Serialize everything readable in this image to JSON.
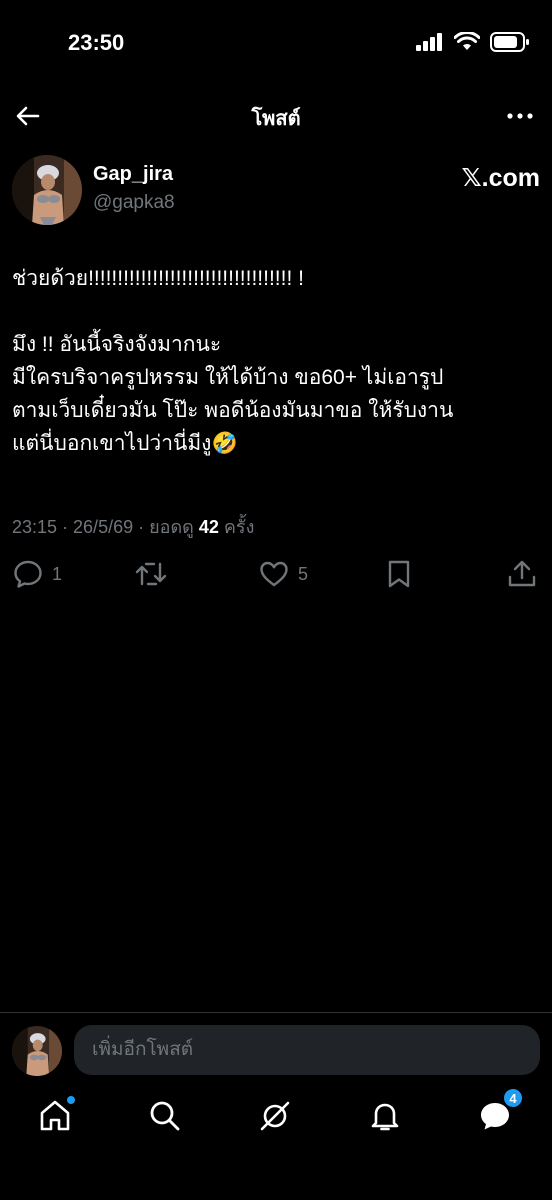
{
  "status": {
    "time": "23:50"
  },
  "nav": {
    "title": "โพสต์"
  },
  "author": {
    "name": "Gap_jira",
    "handle": "@gapka8",
    "source_label": "𝕏.com"
  },
  "post": {
    "text": "ช่วยด้วย!!!!!!!!!!!!!!!!!!!!!!!!!!!!!!!!!!! !\n\nมึง !! อันนี้จริงจังมากนะ\nมีใครบริจาครูปหรรม ให้ได้บ้าง ขอ60+ ไม่เอารูป\nตามเว็บเดี๋ยวมัน โป๊ะ พอดีน้องมันมาขอ ให้รับงาน\nแต่นี่บอกเขาไปว่านี่มีงู🤣",
    "time_date": "23:15 · 26/5/69 · ยอดดู ",
    "views": "42",
    "views_suffix": " ครั้ง"
  },
  "actions": {
    "reply_count": "1",
    "like_count": "5"
  },
  "composer": {
    "placeholder": "เพิ่มอีกโพสต์"
  },
  "tabbar": {
    "messages_badge": "4"
  },
  "colors": {
    "background": "#000000",
    "accent": "#1d9bf0",
    "muted": "#71767b"
  }
}
